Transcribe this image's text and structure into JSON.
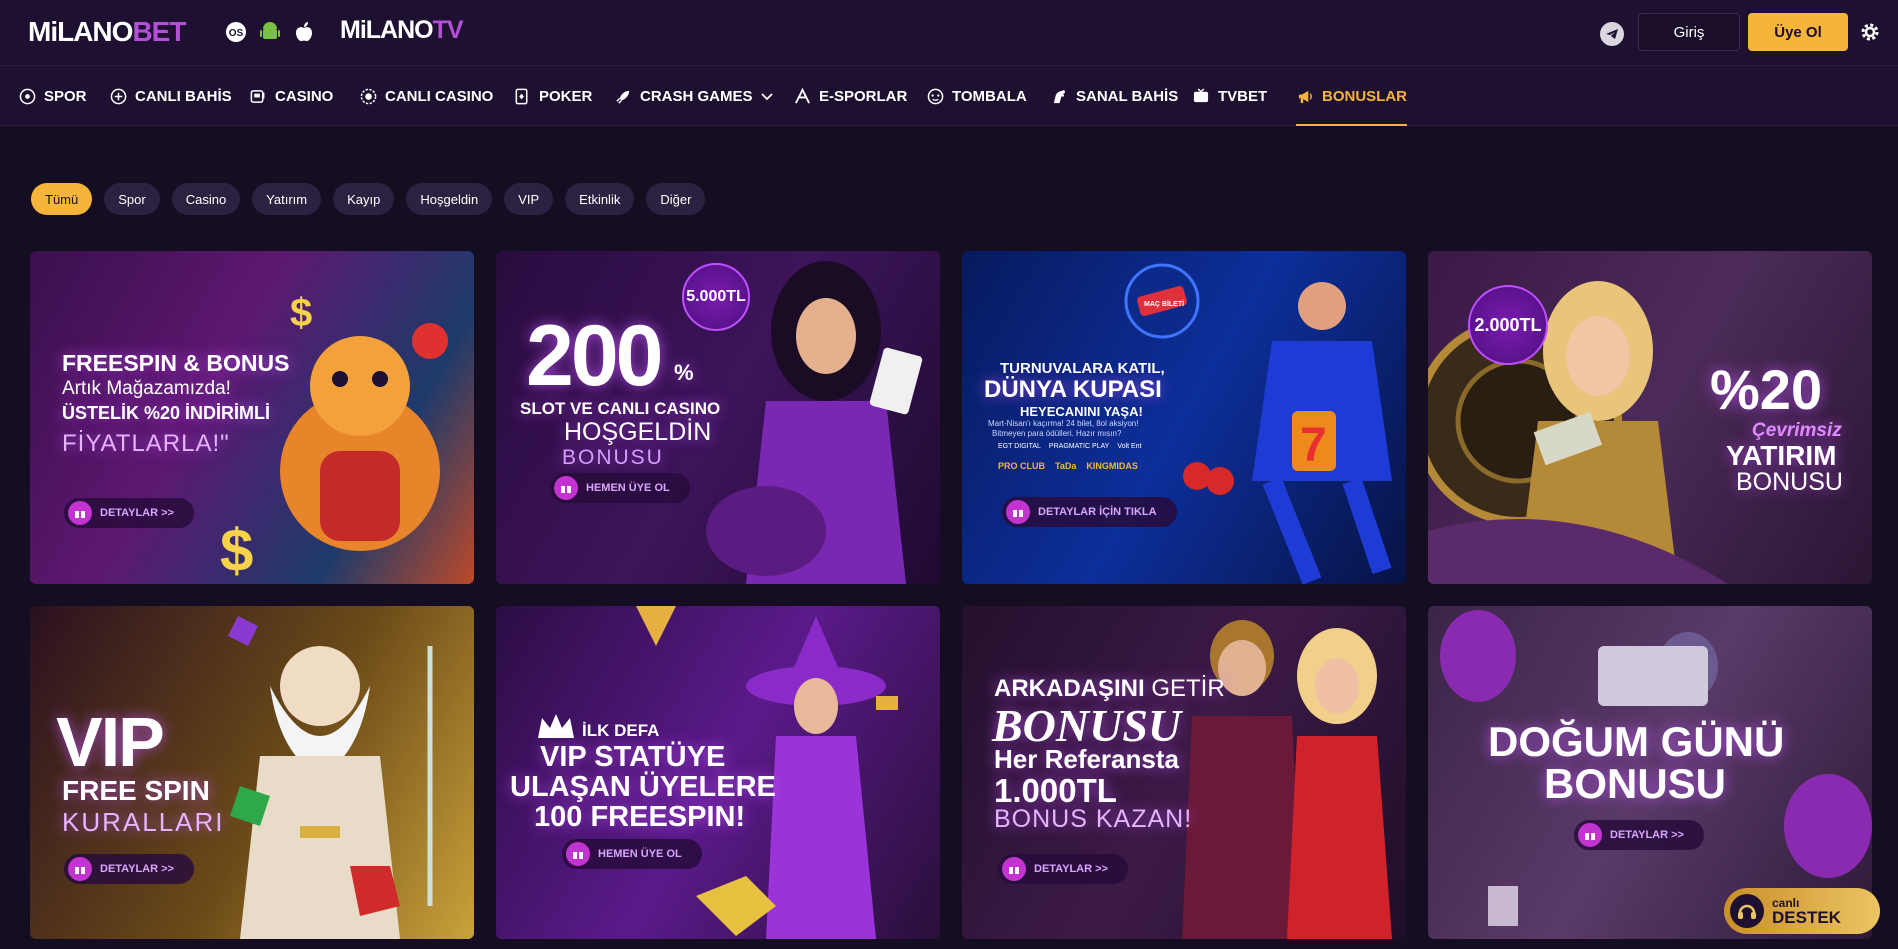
{
  "header": {
    "logo": {
      "part1": "MiLANO",
      "part2": "BET"
    },
    "tv_logo": {
      "part1": "MiLANO",
      "part2": "TV"
    },
    "os_icons": [
      "windows-icon",
      "android-icon",
      "apple-icon"
    ],
    "login_label": "Giriş",
    "register_label": "Üye Ol"
  },
  "nav": {
    "items": [
      {
        "label": "SPOR",
        "icon": "football-icon"
      },
      {
        "label": "CANLI BAHİS",
        "icon": "live-ball-icon"
      },
      {
        "label": "CASINO",
        "icon": "slot-icon"
      },
      {
        "label": "CANLI CASINO",
        "icon": "chip-icon"
      },
      {
        "label": "POKER",
        "icon": "cards-icon"
      },
      {
        "label": "CRASH GAMES",
        "icon": "rocket-icon"
      },
      {
        "label": "E-SPORLAR",
        "icon": "esports-icon"
      },
      {
        "label": "TOMBALA",
        "icon": "bingo-icon"
      },
      {
        "label": "SANAL BAHİS",
        "icon": "horse-icon"
      },
      {
        "label": "TVBET",
        "icon": "tv-icon"
      },
      {
        "label": "BONUSLAR",
        "icon": "megaphone-icon"
      }
    ],
    "active": "BONUSLAR"
  },
  "filters": [
    "Tümü",
    "Spor",
    "Casino",
    "Yatırım",
    "Kayıp",
    "Hoşgeldin",
    "VIP",
    "Etkinlik",
    "Diğer"
  ],
  "active_filter": "Tümü",
  "cards": [
    {
      "line1": "FREESPIN & BONUS",
      "line2": "Artık Mağazamızda!",
      "line3": "ÜSTELİK %20 İNDİRİMLİ",
      "line4": "FİYATLARLA!\"",
      "button": "DETAYLAR >>"
    },
    {
      "badge": "5.000TL",
      "big": "200",
      "percent": "%",
      "line1": "SLOT VE CANLI CASINO",
      "line2": "HOŞGELDİN",
      "line3": "BONUSU",
      "button": "HEMEN ÜYE OL"
    },
    {
      "line1": "TURNUVALARA KATIL,",
      "line2": "DÜNYA KUPASI",
      "line3": "HEYECANINI YAŞA!",
      "small": "Mart-Nisan'ı kaçırma! 24 bilet, 8ol aksiyon!",
      "small2": "Bitmeyen para ödülleri. Hazır mısın?",
      "providers": [
        "EGT DIGITAL",
        "PRAGMATIC PLAY",
        "Volt Ent",
        "PRO CLUB",
        "TaDa",
        "KINGMIDAS"
      ],
      "ticket": "MAÇ BİLETİ",
      "button": "DETAYLAR İÇİN TIKLA"
    },
    {
      "badge": "2.000TL",
      "big": "%20",
      "line1": "Çevrimsiz",
      "line2": "YATIRIM",
      "line3": "BONUSU"
    },
    {
      "line1": "VIP",
      "line2": "FREE SPIN",
      "line3": "KURALLARI",
      "button": "DETAYLAR >>"
    },
    {
      "line0": "İLK DEFA",
      "line1": "VIP STATÜYE",
      "line2": "ULAŞAN ÜYELERE",
      "line3": "100 FREESPIN!",
      "button": "HEMEN ÜYE OL"
    },
    {
      "line1a": "ARKADAŞINI",
      "line1b": "GETİR",
      "line2": "BONUSU",
      "line3": "Her Referansta",
      "line4": "1.000TL",
      "line5": "BONUS KAZAN!",
      "button": "DETAYLAR >>"
    },
    {
      "line1": "DOĞUM GÜNÜ",
      "line2": "BONUSU",
      "button": "DETAYLAR >>"
    }
  ],
  "live_support": {
    "line1": "canlı",
    "line2": "DESTEK"
  },
  "colors": {
    "accent": "#f6b43a",
    "purple": "#b44fd8",
    "bg": "#150d22"
  }
}
